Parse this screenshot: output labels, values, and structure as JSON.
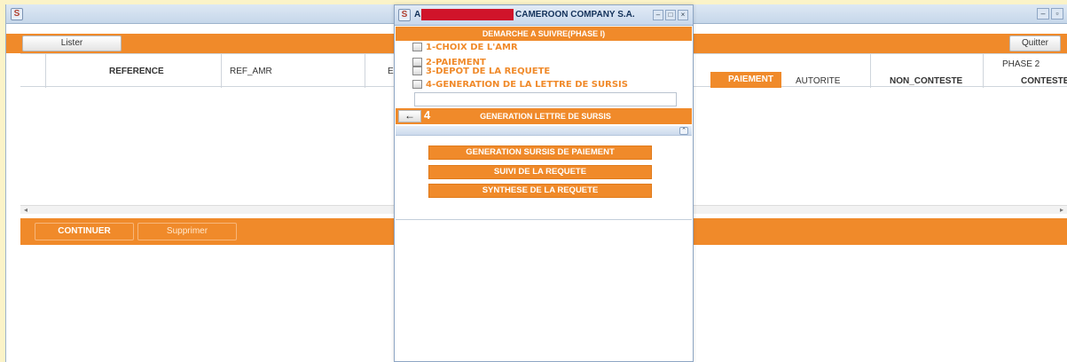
{
  "main": {
    "toolbar": {
      "lister": "Lister",
      "quitter": "Quitter"
    },
    "table": {
      "columns": [
        "REFERENCE",
        "REF_AMR",
        "E",
        "PAIEMENT",
        "AUTORITE",
        "NON_CONTESTE",
        "CONTESTE"
      ],
      "phase_label": "PHASE 2"
    },
    "bottom": {
      "continuer": "CONTINUER",
      "supprimer": "Supprimer"
    }
  },
  "dialog": {
    "title_prefix": "A",
    "title_suffix": "CAMEROON COMPANY S.A.",
    "header": "DEMARCHE A SUIVRE(PHASE I)",
    "steps": [
      "1-CHOIX DE L'AMR",
      "2-PAIEMENT",
      "3-DEPOT DE LA REQUETE",
      "4-GENERATION DE LA LETTRE DE SURSIS"
    ],
    "input_value": "",
    "current_step": "4",
    "section_title": "GENERATION LETTRE DE SURSIS",
    "actions": [
      "GENERATION SURSIS DE PAIEMENT",
      "SUIVI DE LA REQUETE",
      "SYNTHESE DE LA REQUETE"
    ]
  },
  "colors": {
    "accent": "#f08a2a",
    "titlebar": "#c8d8ec",
    "desktop": "#fbf3c8",
    "redaction": "#d0142a"
  },
  "icons": {
    "app": "app-logo-icon",
    "back": "back-arrow-icon",
    "collapse": "collapse-up-icon"
  }
}
